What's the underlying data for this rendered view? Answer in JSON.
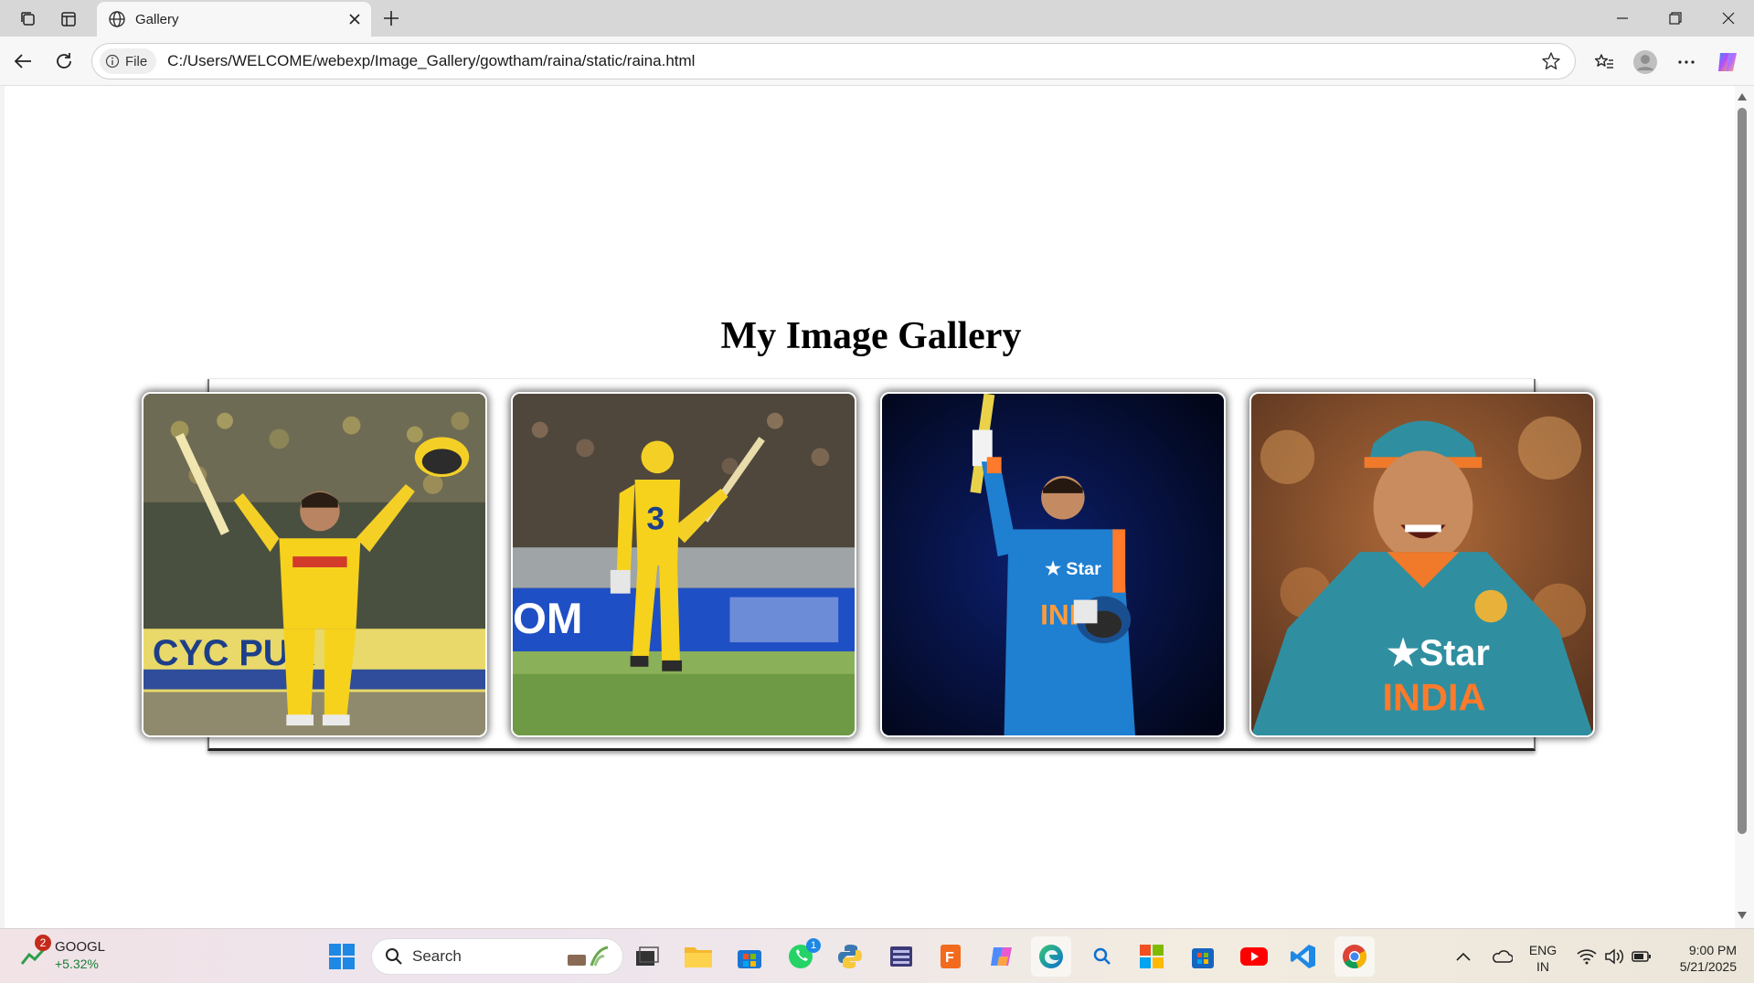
{
  "browser": {
    "tab_title": "Gallery",
    "file_chip": "File",
    "url": "C:/Users/WELCOME/webexp/Image_Gallery/gowtham/raina/static/raina.html"
  },
  "page": {
    "heading": "My Image Gallery",
    "photos": [
      {
        "description": "cricketer in yellow kit raising bat and helmet"
      },
      {
        "description": "cricketer in yellow kit raising bat on field"
      },
      {
        "description": "cricketer in blue India kit raising bat"
      },
      {
        "description": "cricketer in teal India kit with cap smiling"
      }
    ]
  },
  "taskbar": {
    "stock_badge": "2",
    "stock_name": "GOOGL",
    "stock_change": "+5.32%",
    "search_label": "Search",
    "whatsapp_badge": "1",
    "lang_line1": "ENG",
    "lang_line2": "IN",
    "time": "9:00 PM",
    "date": "5/21/2025"
  },
  "colors": {
    "csk_yellow": "#f6d21c",
    "india_blue": "#1f7fd1",
    "india_teal": "#2f8fa0"
  }
}
